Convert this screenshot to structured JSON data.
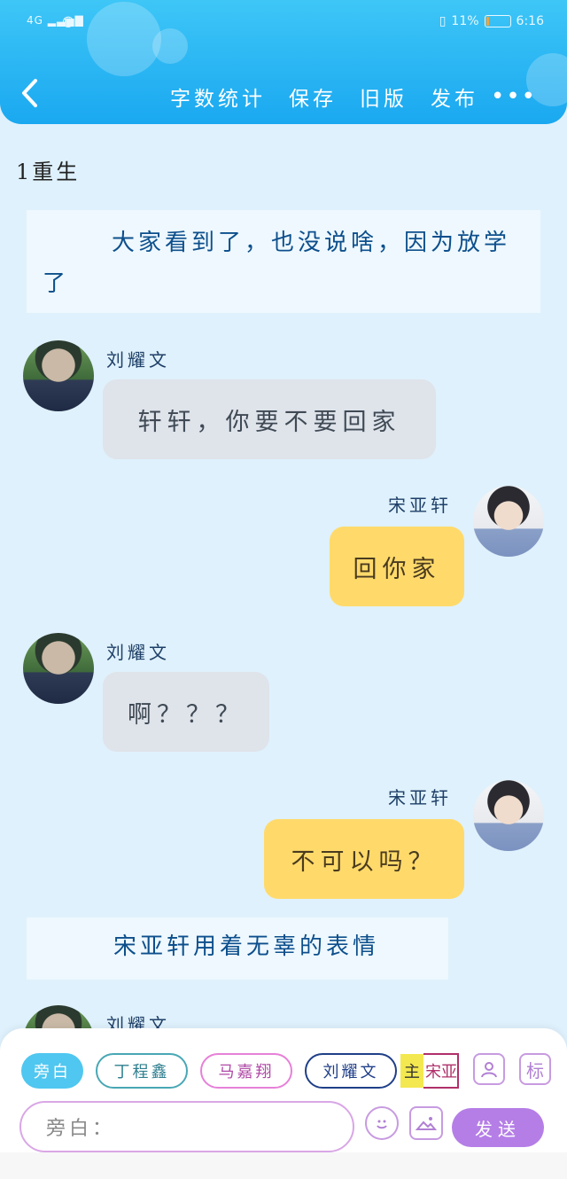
{
  "status_bar": {
    "network": "4G",
    "battery_percent": "11%",
    "time": "6:16",
    "battery_level": 0.11,
    "battery_color": "#f3a33b"
  },
  "header": {
    "back_icon": "chevron-left-icon",
    "actions": [
      "字数统计",
      "保存",
      "旧版",
      "发布"
    ],
    "more_icon": "more-dots-icon",
    "gradient_top": "#3ec6f7",
    "gradient_bottom": "#1aa8f0"
  },
  "story": {
    "title": "1重生",
    "narration_1": "大家看到了，也没说啥，因为放学了",
    "narration_2": "宋亚轩用着无辜的表情",
    "messages": [
      {
        "speaker": "刘耀文",
        "side": "left",
        "text": "轩轩，你要不要回家"
      },
      {
        "speaker": "宋亚轩",
        "side": "right",
        "text": "回你家"
      },
      {
        "speaker": "刘耀文",
        "side": "left",
        "text": "啊？？？"
      },
      {
        "speaker": "宋亚轩",
        "side": "right",
        "text": "不可以吗？"
      },
      {
        "speaker": "刘耀文",
        "side": "left",
        "text": ""
      }
    ]
  },
  "composer": {
    "roles": [
      "旁白",
      "丁程鑫",
      "马嘉翔",
      "刘耀文"
    ],
    "main_tag": "主",
    "main_role": "宋亚",
    "person_icon": "person-icon",
    "tag_button": "标",
    "input_placeholder": "旁白：",
    "emoji_icon": "smile-icon",
    "image_icon": "image-icon",
    "send_label": "发送"
  }
}
